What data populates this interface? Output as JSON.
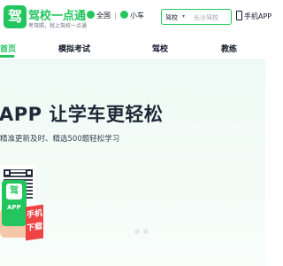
{
  "header": {
    "logo_glyph": "驾",
    "brand": "驾校一点通",
    "tagline": "考驾照，就上驾校一点通",
    "city_label": "全国",
    "vehicle_label": "小车",
    "search": {
      "school_label": "驾校",
      "placeholder": "长沙驾校"
    },
    "app_label": "手机APP"
  },
  "nav": {
    "items": [
      {
        "label": "首页"
      },
      {
        "label": "模拟考试"
      },
      {
        "label": "驾校"
      },
      {
        "label": "教练"
      }
    ]
  },
  "banner": {
    "headline": "APP 让学车更轻松",
    "subhead": "精准更新及时、精选500题轻松学习",
    "phone_logo": "驾",
    "phone_app": "APP",
    "phone_tag": "手机下载"
  },
  "colors": {
    "brand": "#22c55e",
    "accent_red": "#ef4444"
  }
}
